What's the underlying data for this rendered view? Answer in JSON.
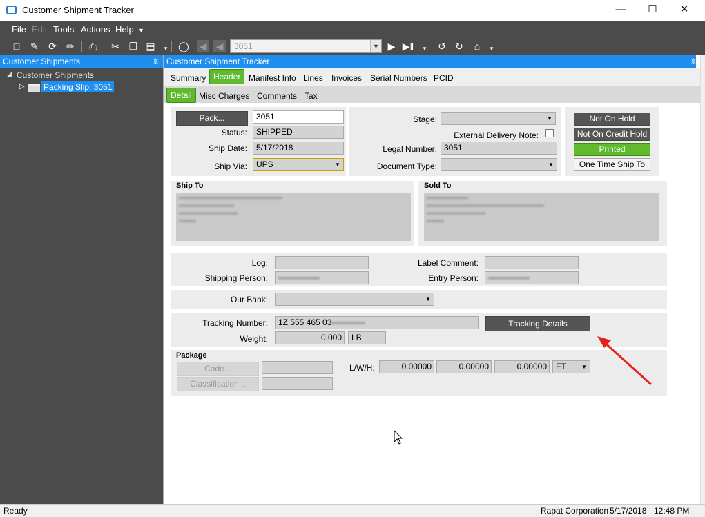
{
  "window": {
    "title": "Customer Shipment Tracker"
  },
  "menu": [
    "File",
    "Edit",
    "Tools",
    "Actions",
    "Help"
  ],
  "toolbar": {
    "record_value": "3051"
  },
  "tree": {
    "header": "Customer Shipments",
    "root": "Customer Shipments",
    "child": "Packing Slip: 3051"
  },
  "panel": {
    "header": "Customer Shipment Tracker"
  },
  "tabs": [
    "Summary",
    "Header",
    "Manifest Info",
    "Lines",
    "Invoices",
    "Serial Numbers",
    "PCID"
  ],
  "subtabs": [
    "Detail",
    "Misc Charges",
    "Comments",
    "Tax"
  ],
  "form": {
    "pack_button": "Pack...",
    "pack_value": "3051",
    "status_label": "Status:",
    "status_value": "SHIPPED",
    "ship_date_label": "Ship Date:",
    "ship_date_value": "5/17/2018",
    "ship_via_label": "Ship Via:",
    "ship_via_value": "UPS",
    "stage_label": "Stage:",
    "external_delivery_label": "External Delivery Note:",
    "legal_number_label": "Legal Number:",
    "legal_number_value": "3051",
    "document_type_label": "Document Type:",
    "not_on_hold": "Not On Hold",
    "not_on_credit_hold": "Not On Credit Hold",
    "printed": "Printed",
    "one_time_ship_to": "One Time Ship To",
    "ship_to_label": "Ship To",
    "sold_to_label": "Sold To",
    "log_label": "Log:",
    "label_comment_label": "Label Comment:",
    "shipping_person_label": "Shipping Person:",
    "entry_person_label": "Entry Person:",
    "our_bank_label": "Our Bank:",
    "tracking_number_label": "Tracking Number:",
    "tracking_number_value": "1Z 555 465 03",
    "tracking_details_button": "Tracking Details",
    "weight_label": "Weight:",
    "weight_value": "0.000",
    "weight_unit": "LB",
    "package_label": "Package",
    "code_button": "Code...",
    "classification_button": "Classification...",
    "lwh_label": "L/W/H:",
    "length_value": "0.00000",
    "width_value": "0.00000",
    "height_value": "0.00000",
    "dim_unit": "FT"
  },
  "status": {
    "text": "Ready",
    "company": "Rapat Corporation",
    "date": "5/17/2018",
    "time": "12:48 PM"
  },
  "colors": {
    "accent": "#1e8ff0",
    "active_tab": "#5fba2e",
    "annotation": "#e8201c"
  }
}
